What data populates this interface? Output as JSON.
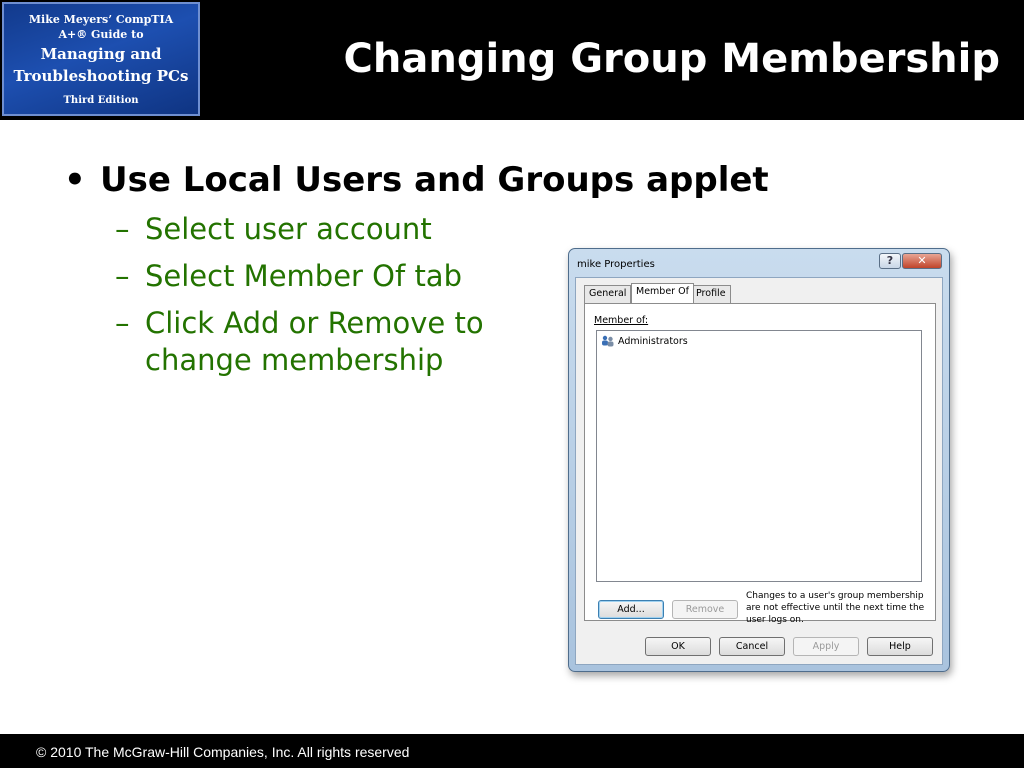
{
  "header": {
    "book": {
      "line1": "Mike Meyers’ CompTIA",
      "line2": "A+® Guide to",
      "line3": "Managing and",
      "line4": "Troubleshooting PCs",
      "line5": "Third Edition"
    },
    "title": "Changing Group Membership"
  },
  "bullets": {
    "main": "Use Local Users and Groups applet",
    "marker": "•",
    "dash": "–",
    "sub": [
      "Select user account",
      "Select Member Of tab",
      "Click Add or Remove to",
      "change membership"
    ]
  },
  "dialog": {
    "title": "mike Properties",
    "help_glyph": "?",
    "close_glyph": "✕",
    "tabs": [
      "General",
      "Member Of",
      "Profile"
    ],
    "active_tab": "Member Of",
    "member_of_label": "Member of:",
    "groups": [
      "Administrators"
    ],
    "group_icon": "group-icon",
    "add_label": "Add...",
    "remove_label": "Remove",
    "note": "Changes to a user's group membership are not effective until the next time the user logs on.",
    "ok_label": "OK",
    "cancel_label": "Cancel",
    "apply_label": "Apply",
    "help_label": "Help"
  },
  "footer": {
    "copyright": "© 2010 The McGraw-Hill Companies, Inc. All rights reserved"
  },
  "colors": {
    "header_bg": "#000000",
    "title_text": "#ffffff",
    "sub_bullet": "#237300",
    "book_cover": "#1d4fb0"
  }
}
